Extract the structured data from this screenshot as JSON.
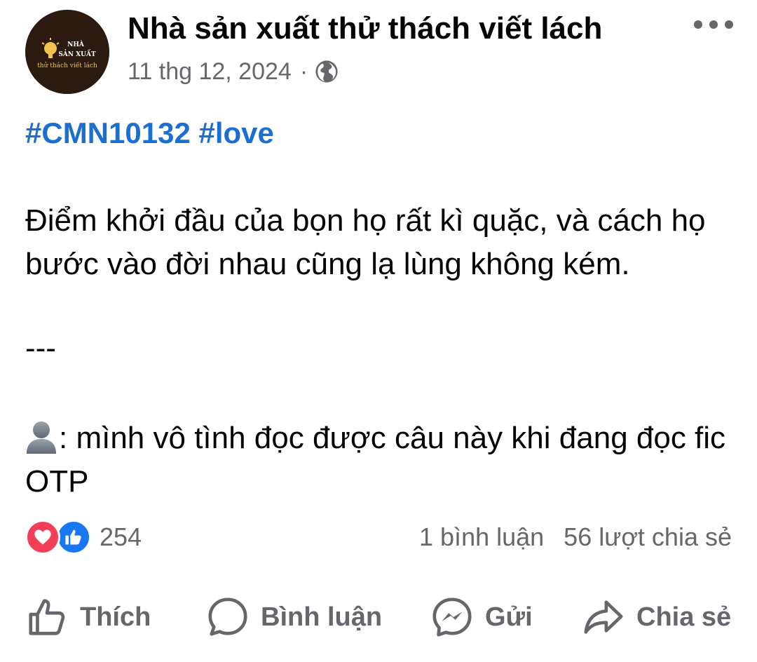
{
  "header": {
    "page_name": "Nhà sản xuất thử thách viết lách",
    "date": "11 thg 12, 2024",
    "separator": "·",
    "privacy_icon": "globe-icon",
    "more_icon": "more-dots-icon",
    "avatar": {
      "line1": "NHÀ",
      "line2": "SẢN XUẤT",
      "line3": "thử thách viết lách",
      "bg_color": "#2b1a0f"
    }
  },
  "post": {
    "hashtags": [
      "#CMN10132",
      "#love"
    ],
    "paragraph1": "Điểm khởi đầu của bọn họ rất kì quặc, và cách họ bước vào đời nhau cũng lạ lùng không kém.",
    "divider": "---",
    "paragraph3_icon": "person-silhouette-icon",
    "paragraph3": ": mình vô tình đọc được câu này khi đang đọc fic OTP"
  },
  "reactions": {
    "icons": [
      "love-icon",
      "like-icon"
    ],
    "count": "254",
    "comments": "1 bình luận",
    "shares": "56 lượt chia sẻ"
  },
  "actions": {
    "like": "Thích",
    "comment": "Bình luận",
    "send": "Gửi",
    "share": "Chia sẻ"
  },
  "colors": {
    "hashtag": "#1b6fd0",
    "secondary_text": "#65676b",
    "love": "#f33e58",
    "like": "#1877f2"
  }
}
